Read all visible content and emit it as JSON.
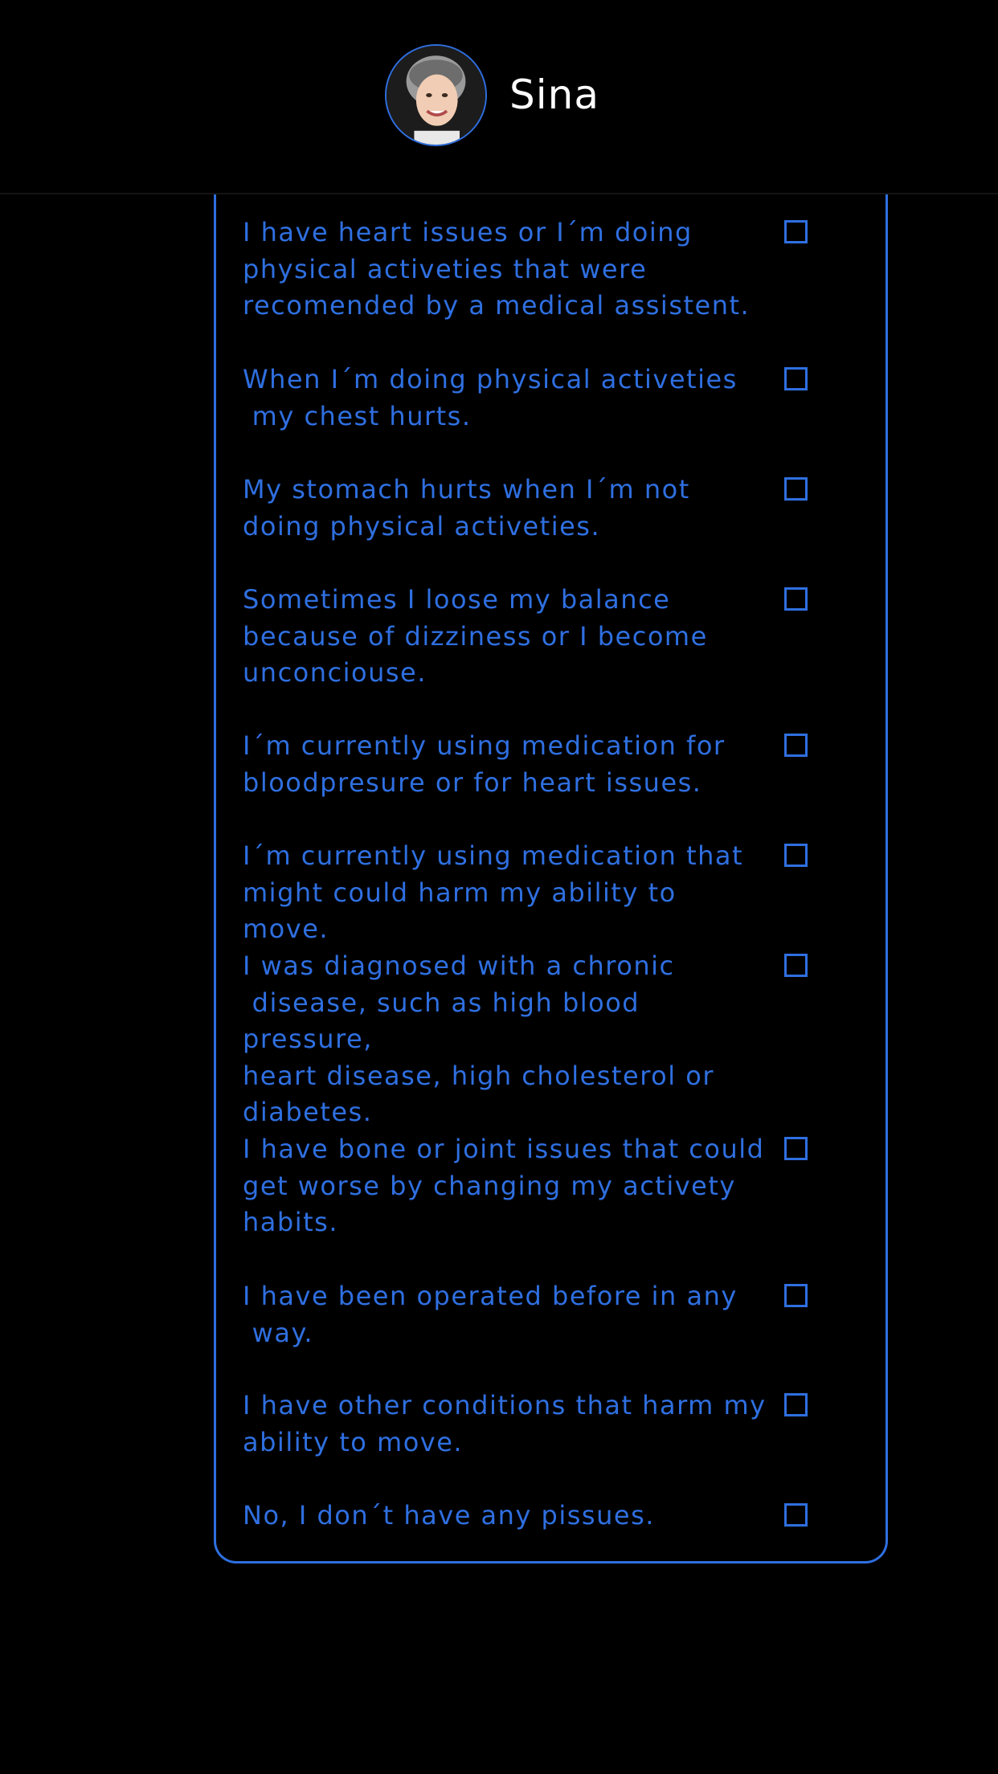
{
  "header": {
    "name": "Sina"
  },
  "questions": [
    {
      "label": "I have heart issues or I´m doing\nphysical activeties that were\nrecomended by a medical assistent.",
      "checked": false
    },
    {
      "label": "When I´m doing physical activeties\n my chest hurts.",
      "checked": false
    },
    {
      "label": "My stomach hurts when I´m not\ndoing physical activeties.",
      "checked": false
    },
    {
      "label": "Sometimes I loose my balance\nbecause of dizziness or I become\nunconciouse.",
      "checked": false
    },
    {
      "label": "I´m currently using medication for\nbloodpresure or for heart issues.",
      "checked": false
    },
    {
      "label": "I´m currently using medication that\nmight could harm my ability to move.",
      "checked": false
    },
    {
      "label": "I was diagnosed with a chronic\n disease, such as high blood pressure,\nheart disease, high cholesterol or\ndiabetes.",
      "checked": false
    },
    {
      "label": "I have bone or joint issues that could\nget worse by changing my activety\nhabits.",
      "checked": false
    },
    {
      "label": "I have been operated before in any\n way.",
      "checked": false
    },
    {
      "label": "I have other conditions that harm my\nability to move.",
      "checked": false
    },
    {
      "label": "No, I don´t have any pissues.",
      "checked": false
    }
  ],
  "colors": {
    "accent": "#2f6fe0",
    "background": "#000000",
    "name_text": "#ffffff"
  }
}
